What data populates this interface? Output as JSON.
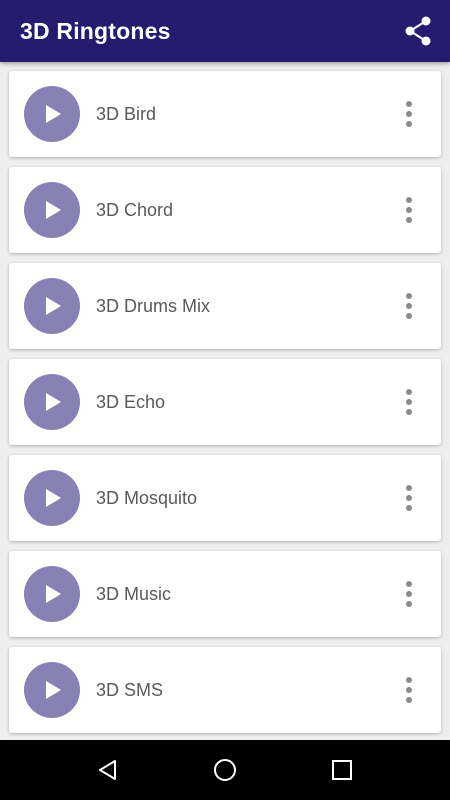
{
  "app_bar": {
    "title": "3D Ringtones",
    "share_icon": "share-icon",
    "background": "#241c6e"
  },
  "ringtones": [
    {
      "label": "3D Bird"
    },
    {
      "label": "3D Chord"
    },
    {
      "label": "3D Drums Mix"
    },
    {
      "label": "3D Echo"
    },
    {
      "label": "3D Mosquito"
    },
    {
      "label": "3D Music"
    },
    {
      "label": "3D SMS"
    }
  ],
  "icons": {
    "play": "play-icon",
    "more": "more-vertical-icon"
  },
  "colors": {
    "accent": "#8781b5",
    "card": "#ffffff",
    "background": "#eeeeee"
  },
  "nav_bar": {
    "back": "back-icon",
    "home": "home-icon",
    "recents": "recents-icon"
  }
}
